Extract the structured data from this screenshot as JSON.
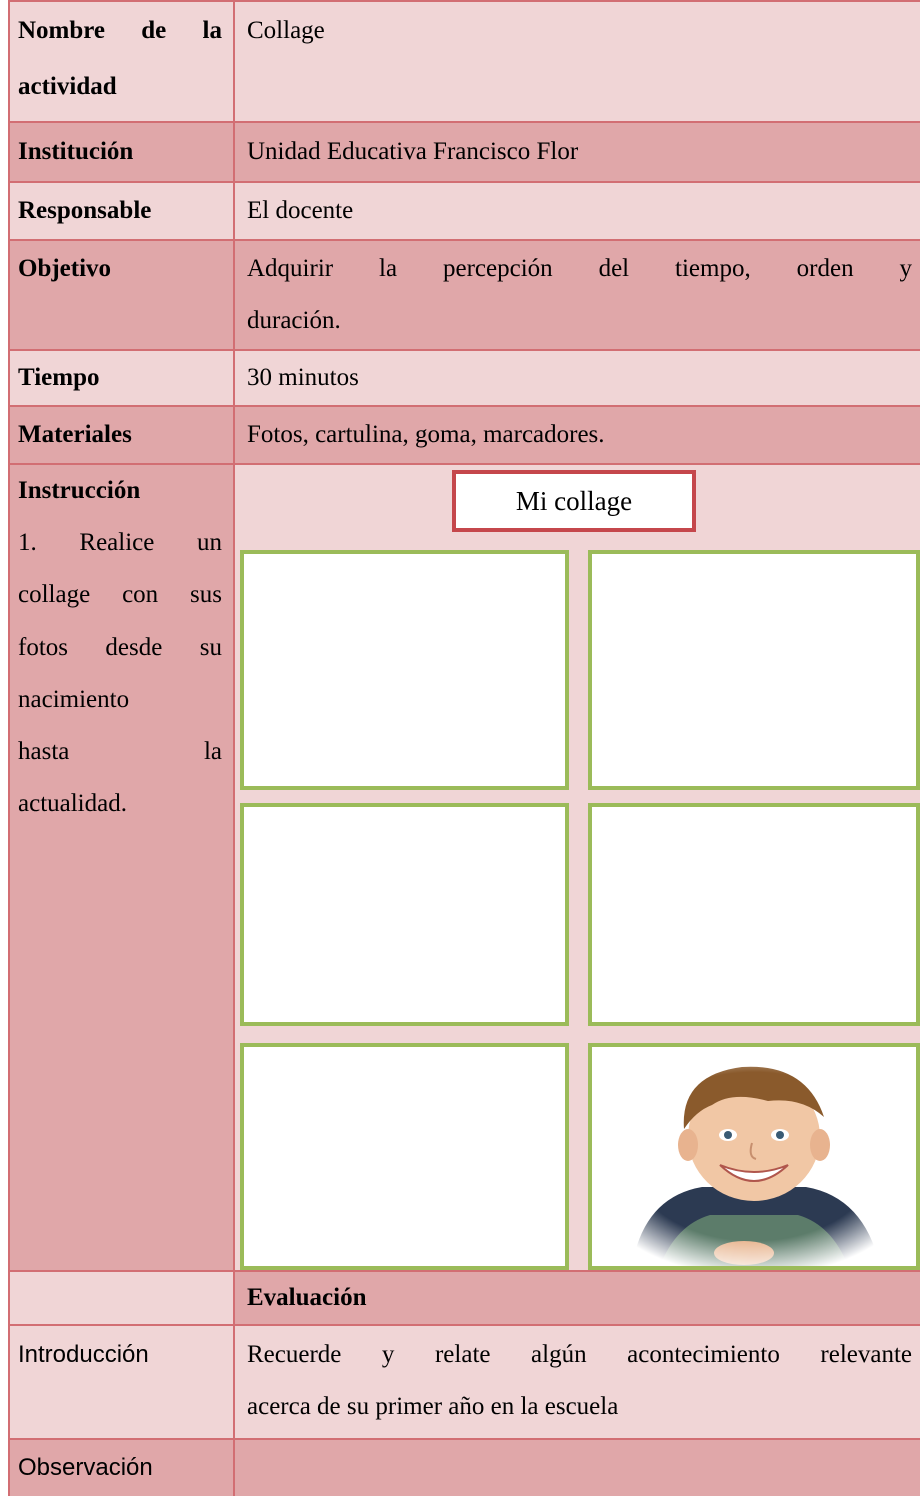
{
  "rows": {
    "nombre": {
      "label_line1": "Nombre de la",
      "label_line2": "actividad",
      "value": "Collage"
    },
    "institucion": {
      "label": "Institución",
      "value": "Unidad Educativa Francisco Flor"
    },
    "responsable": {
      "label": "Responsable",
      "value": "El docente"
    },
    "objetivo": {
      "label": "Objetivo",
      "value_line1": "Adquirir la percepción del tiempo, orden y",
      "value_line2": "duración."
    },
    "tiempo": {
      "label": "Tiempo",
      "value": "30 minutos"
    },
    "materiales": {
      "label": "Materiales",
      "value": "Fotos, cartulina, goma, marcadores."
    },
    "instruccion": {
      "label": "Instrucción",
      "lines": [
        "1. Realice un",
        "collage con sus",
        "fotos desde su",
        "nacimiento",
        "hasta la",
        "actualidad."
      ],
      "collage_title": "Mi collage",
      "frames": [
        "empty",
        "empty",
        "empty",
        "empty",
        "empty",
        "child-photo"
      ]
    },
    "evaluacion": {
      "heading": "Evaluación"
    },
    "introduccion": {
      "label": "Introducción",
      "value_line1": "Recuerde y relate algún acontecimiento relevante",
      "value_line2": "acerca de su primer año en la escuela"
    },
    "observacion": {
      "label": "Observación",
      "value": ""
    }
  },
  "colors": {
    "light_row": "#f0d5d6",
    "dark_row": "#e0a7a9",
    "border": "#d26e73",
    "frame_border": "#9bbb59",
    "title_border": "#c5474c"
  }
}
